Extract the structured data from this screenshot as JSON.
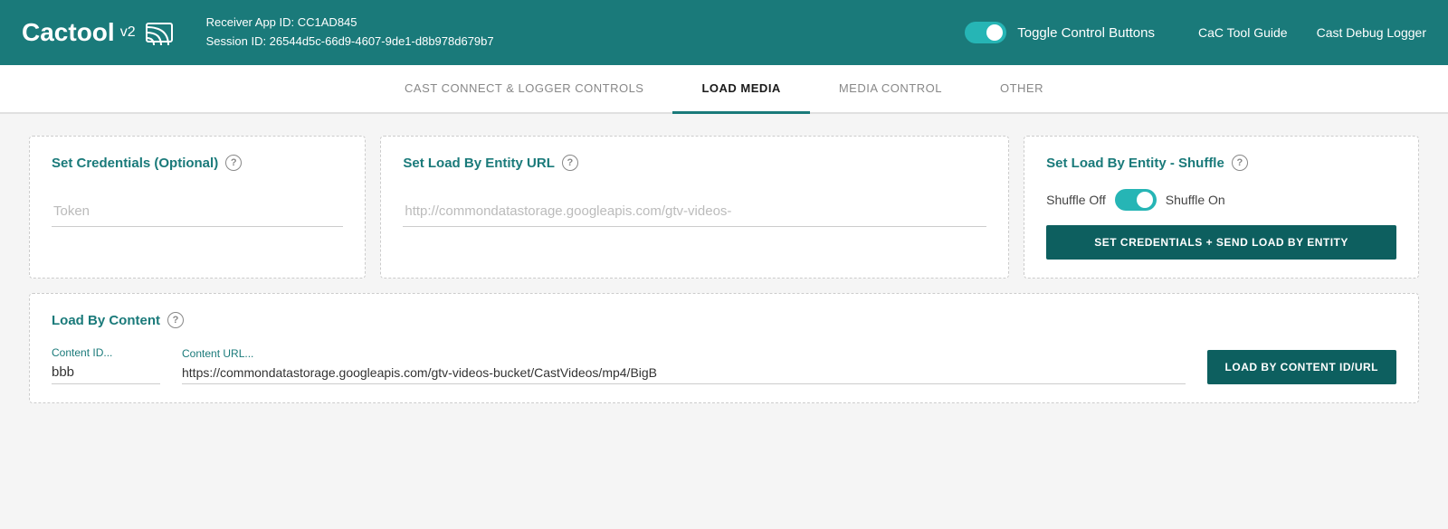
{
  "header": {
    "logo_text": "Cactool",
    "logo_version": "v2",
    "receiver_app_id_label": "Receiver App ID: CC1AD845",
    "session_id_label": "Session ID: 26544d5c-66d9-4607-9de1-d8b978d679b7",
    "toggle_label": "Toggle Control Buttons",
    "toggle_state": true,
    "nav_links": [
      {
        "id": "cac-tool-guide",
        "label": "CaC Tool Guide"
      },
      {
        "id": "cast-debug-logger",
        "label": "Cast Debug Logger"
      }
    ]
  },
  "tabs": [
    {
      "id": "cast-connect",
      "label": "CAST CONNECT & LOGGER CONTROLS",
      "active": false
    },
    {
      "id": "load-media",
      "label": "LOAD MEDIA",
      "active": true
    },
    {
      "id": "media-control",
      "label": "MEDIA CONTROL",
      "active": false
    },
    {
      "id": "other",
      "label": "OTHER",
      "active": false
    }
  ],
  "main": {
    "cards_row1": {
      "credentials": {
        "title": "Set Credentials (Optional)",
        "token_placeholder": "Token"
      },
      "entity_url": {
        "title": "Set Load By Entity URL",
        "url_placeholder": "http://commondatastorage.googleapis.com/gtv-videos-"
      },
      "shuffle": {
        "title": "Set Load By Entity - Shuffle",
        "shuffle_off_label": "Shuffle Off",
        "shuffle_on_label": "Shuffle On",
        "shuffle_state": true,
        "button_label": "SET CREDENTIALS + SEND LOAD BY ENTITY"
      }
    },
    "load_by_content": {
      "title": "Load By Content",
      "content_id_label": "Content ID...",
      "content_id_value": "bbb",
      "content_url_label": "Content URL...",
      "content_url_value": "https://commondatastorage.googleapis.com/gtv-videos-bucket/CastVideos/mp4/BigB",
      "button_label": "LOAD BY CONTENT ID/URL"
    }
  },
  "colors": {
    "teal_dark": "#1a7a7a",
    "teal_button": "#0d5f5f",
    "toggle_active": "#26b5b5"
  }
}
